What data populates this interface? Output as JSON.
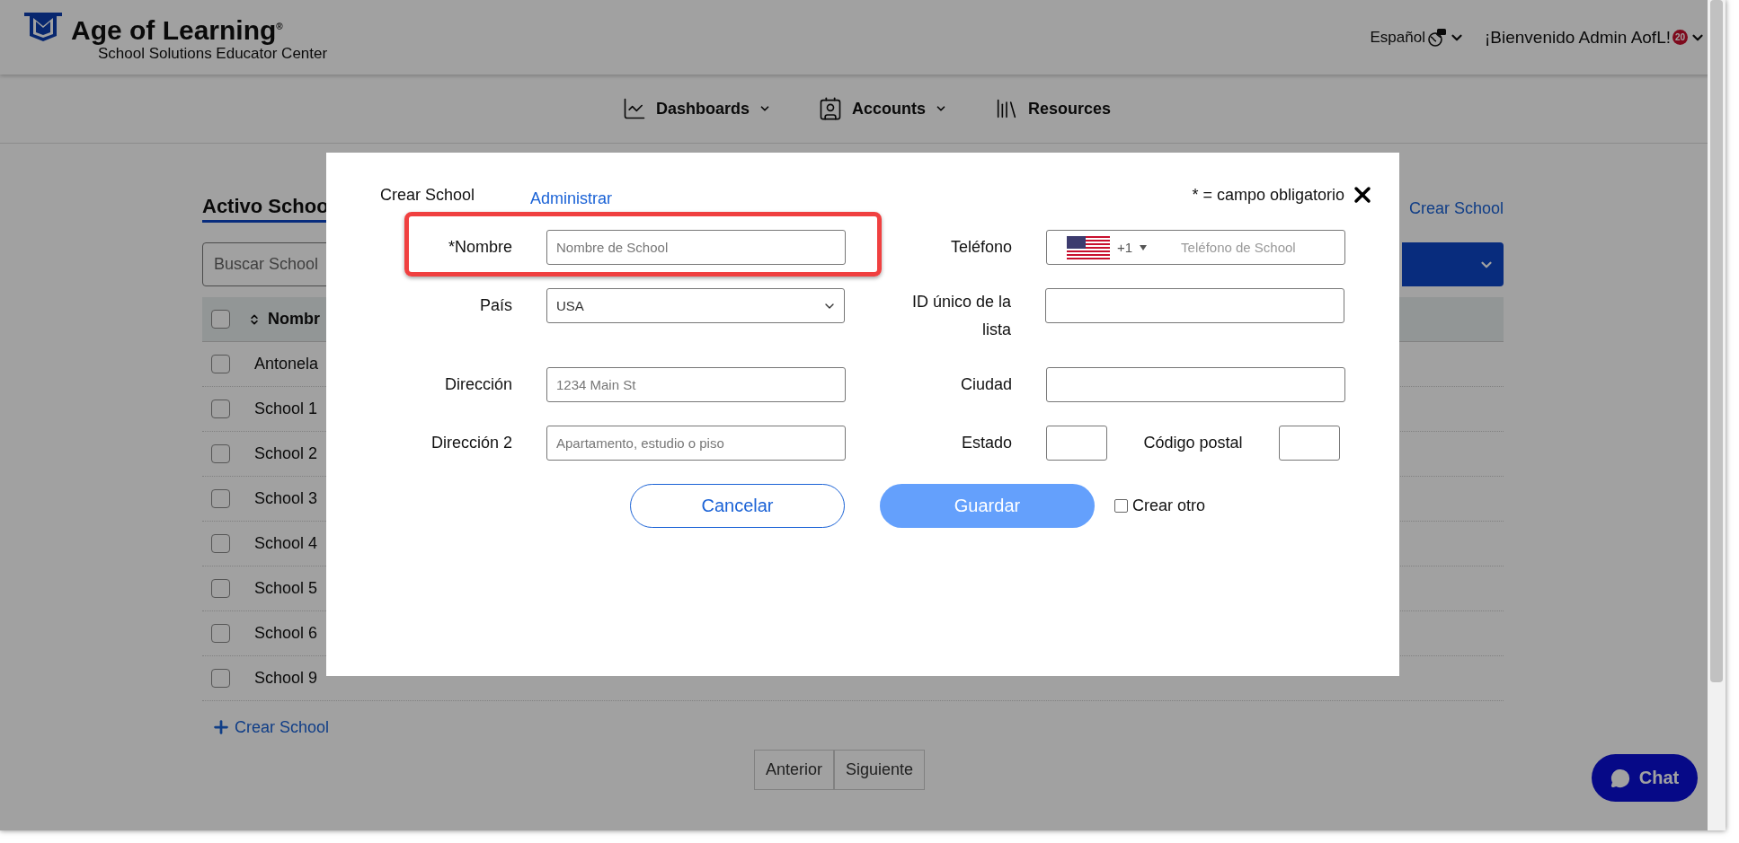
{
  "header": {
    "brand": "Age of Learning$^{®}$",
    "subtitle": "School Solutions Educator Center",
    "language": "Español",
    "welcome": "¡Bienvenido Admin AofL!",
    "badge": "20"
  },
  "nav": [
    {
      "label": "Dashboards",
      "kind": "chart",
      "has_menu": true
    },
    {
      "label": "Accounts",
      "kind": "contact",
      "has_menu": true
    },
    {
      "label": "Resources",
      "kind": "books",
      "has_menu": false
    }
  ],
  "background": {
    "title": "Activo Schoo",
    "create_link": "Crear School",
    "search_placeholder": "Buscar School",
    "column_1": "Nombr",
    "header_checked": false,
    "rows": [
      {
        "name": "Antonela",
        "checked": false
      },
      {
        "name": "School 1",
        "checked": false
      },
      {
        "name": "School 2",
        "checked": false
      },
      {
        "name": "School 3",
        "checked": false
      },
      {
        "name": "School 4",
        "checked": false
      },
      {
        "name": "School 5",
        "checked": false
      },
      {
        "name": "School 6",
        "checked": false
      },
      {
        "name": "School 9",
        "checked": false
      }
    ],
    "add_link": "Crear School",
    "pagination": [
      "Anterior",
      "Siguiente"
    ],
    "chat": "Chat"
  },
  "modal": {
    "title": "Crear School",
    "manage_link": "Administrar",
    "required_note": "* = campo obligatorio",
    "rows": [
      {
        "left": {
          "label": "*Nombre",
          "kind": "text",
          "placeholder": "Nombre de School",
          "highlighted": true
        },
        "right": [
          {
            "label": "Teléfono",
            "kind": "phone",
            "code": "+1",
            "placeholder": "Teléfono de School"
          }
        ]
      },
      {
        "left": {
          "label": "País",
          "kind": "select",
          "value": "USA"
        },
        "right": [
          {
            "label": "ID único de la lista",
            "kind": "text"
          }
        ]
      },
      {
        "left": {
          "label": "Dirección",
          "kind": "text",
          "placeholder": "1234 Main St"
        },
        "right": [
          {
            "label": "Ciudad",
            "kind": "text"
          }
        ]
      },
      {
        "left": {
          "label": "Dirección 2",
          "kind": "text",
          "placeholder": "Apartamento, estudio o piso"
        },
        "right": [
          {
            "label": "Estado",
            "kind": "short"
          },
          {
            "label": "Código postal",
            "kind": "short"
          }
        ]
      }
    ],
    "buttons": [
      {
        "label": "Cancelar",
        "kind": "outline"
      },
      {
        "label": "Guardar",
        "kind": "primary"
      }
    ],
    "another": {
      "label": "Crear otro",
      "checked": false
    }
  }
}
